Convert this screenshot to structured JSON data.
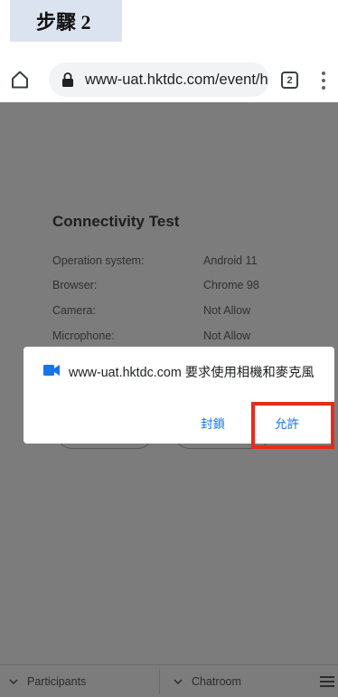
{
  "step_badge": "步驟 2",
  "browser": {
    "url": "www-uat.hktdc.com/event/h",
    "tab_count": "2",
    "icons": [
      "home-icon",
      "lock-icon",
      "tabs-icon",
      "more-vert-icon"
    ]
  },
  "page": {
    "title": "Connectivity Test",
    "rows": [
      {
        "label": "Operation system:",
        "value": "Android 11"
      },
      {
        "label": "Browser:",
        "value": "Chrome 98"
      },
      {
        "label": "Camera:",
        "value": "Not Allow"
      },
      {
        "label": "Microphone:",
        "value": "Not Allow"
      }
    ]
  },
  "permission_dialog": {
    "message": "www-uat.hktdc.com 要求使用相機和麥克風",
    "block_label": "封鎖",
    "allow_label": "允許"
  },
  "bottom_bar": {
    "participants_label": "Participants",
    "chatroom_label": "Chatroom"
  },
  "colors": {
    "accent": "#1a73e8",
    "highlight": "#e62b1e",
    "camera_icon": "#1a73e8",
    "overlay": "#7c7c7c"
  }
}
